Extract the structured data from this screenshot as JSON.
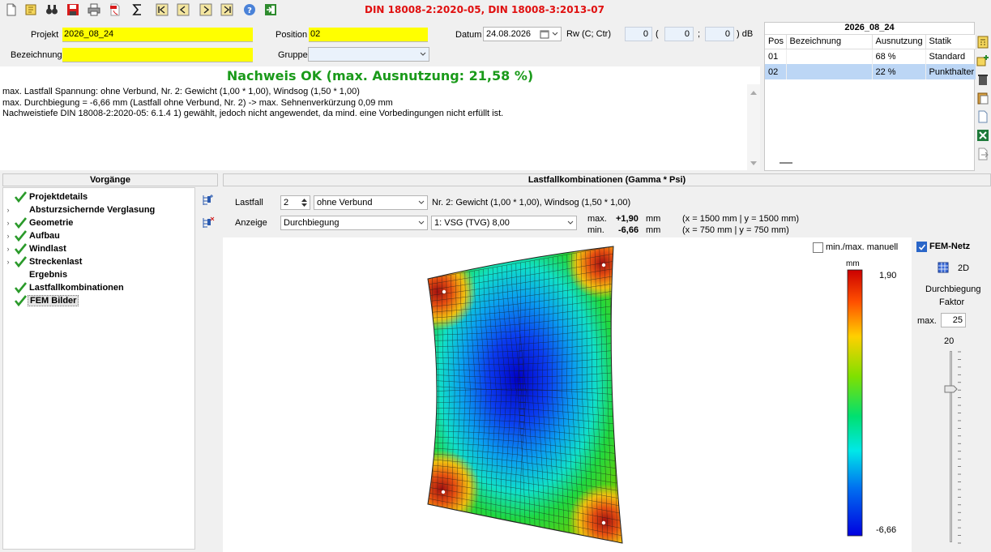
{
  "toolbar": {
    "title": "DIN 18008-2:2020-05, DIN 18008-3:2013-07",
    "buttons": [
      "new-icon",
      "open-icon",
      "binoculars-icon",
      "save-icon",
      "print-icon",
      "pdf-icon",
      "sum-icon",
      "first-icon",
      "prev-icon",
      "next-icon",
      "last-icon",
      "help-icon",
      "exit-icon"
    ]
  },
  "header": {
    "projekt_label": "Projekt",
    "projekt_value": "2026_08_24",
    "bezeichnung_label": "Bezeichnung",
    "bezeichnung_value": "",
    "position_label": "Position",
    "position_value": "02",
    "gruppe_label": "Gruppe",
    "gruppe_value": "",
    "datum_label": "Datum",
    "datum_value": "24.08.2026",
    "rw_label": "Rw (C; Ctr)",
    "rw_value": "0",
    "c_value": "0",
    "ctr_value": "0",
    "paren_open": "(",
    "semicolon": ";",
    "paren_close_unit": ") dB"
  },
  "pos_list": {
    "title": "2026_08_24",
    "columns": [
      "Pos",
      "Bezeichnung",
      "Ausnutzung",
      "Statik"
    ],
    "rows": [
      {
        "pos": "01",
        "bez": "",
        "aus": "68 %",
        "statik": "Standard"
      },
      {
        "pos": "02",
        "bez": "",
        "aus": "22 %",
        "statik": "Punkthalter"
      }
    ],
    "selected_row": 1
  },
  "results": {
    "title": "Nachweis OK (max. Ausnutzung: 21,58 %)",
    "lines": [
      "max. Lastfall Spannung: ohne Verbund, Nr. 2:  Gewicht (1,00 * 1,00), Windsog (1,50 * 1,00)",
      "max. Durchbiegung = -6,66 mm (Lastfall ohne Verbund, Nr. 2) -> max. Sehnenverkürzung 0,09 mm",
      "Nachweistiefe DIN 18008-2:2020-05: 6.1.4 1) gewählt, jedoch nicht angewendet, da mind. eine Vorbedingungen nicht erfüllt ist."
    ]
  },
  "vorgaenge": {
    "title": "Vorgänge",
    "items": [
      {
        "label": "Projektdetails",
        "checked": true,
        "expandable": false
      },
      {
        "label": "Absturzsichernde Verglasung",
        "checked": false,
        "expandable": true
      },
      {
        "label": "Geometrie",
        "checked": true,
        "expandable": true
      },
      {
        "label": "Aufbau",
        "checked": true,
        "expandable": true
      },
      {
        "label": "Windlast",
        "checked": true,
        "expandable": true
      },
      {
        "label": "Streckenlast",
        "checked": true,
        "expandable": true
      },
      {
        "label": "Ergebnis",
        "checked": false,
        "expandable": false
      },
      {
        "label": "Lastfallkombinationen",
        "checked": true,
        "expandable": false
      },
      {
        "label": "FEM Bilder",
        "checked": true,
        "expandable": false,
        "selected": true
      }
    ]
  },
  "main": {
    "title": "Lastfallkombinationen (Gamma * Psi)",
    "lastfall_label": "Lastfall",
    "lastfall_value": "2",
    "verbund_value": "ohne Verbund",
    "lastfall_desc": "Nr. 2:  Gewicht (1,00 * 1,00), Windsog (1,50 * 1,00)",
    "anzeige_label": "Anzeige",
    "anzeige_value": "Durchbiegung",
    "schicht_value": "1: VSG (TVG) 8,00",
    "max_label": "max.",
    "max_value": "+1,90",
    "min_label": "min.",
    "min_value": "-6,66",
    "unit_mm": "mm",
    "max_coords": "(x = 1500 mm | y = 1500 mm)",
    "min_coords": "(x = 750 mm | y = 750 mm)",
    "minmax_manual_label": "min./max. manuell",
    "legend_unit": "mm",
    "legend_max": "1,90",
    "legend_min": "-6,66"
  },
  "fem": {
    "netz_label": "FEM-Netz",
    "netz_checked": true,
    "mode_2d": "2D",
    "durchbiegung_label": "Durchbiegung",
    "faktor_label": "Faktor",
    "max_label": "max.",
    "max_value": "25",
    "slider_value": "20"
  }
}
